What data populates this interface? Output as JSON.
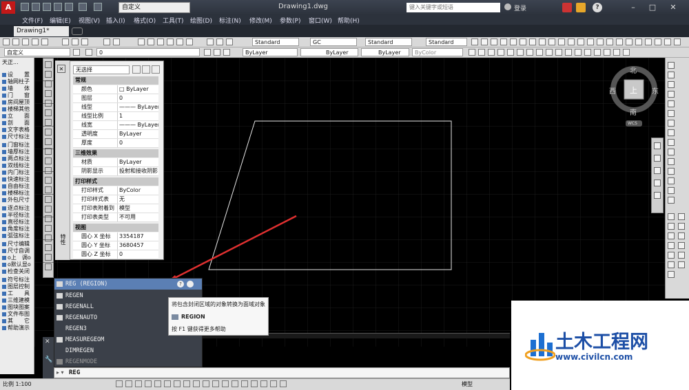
{
  "titlebar": {
    "app_logo": "A",
    "workspace": "自定义",
    "doc_title": "Drawing1.dwg",
    "search_placeholder": "键入关键字或短语",
    "login": "登录",
    "min": "–",
    "max": "□",
    "close": "✕"
  },
  "menu": [
    "文件(F)",
    "编辑(E)",
    "视图(V)",
    "插入(I)",
    "格式(O)",
    "工具(T)",
    "绘图(D)",
    "标注(N)",
    "修改(M)",
    "参数(P)",
    "窗口(W)",
    "帮助(H)"
  ],
  "tabs": {
    "active": "Drawing1*"
  },
  "toolbar2": {
    "text_style": "Standard",
    "dim_style": "GC",
    "table_style": "Standard",
    "mleader_style": "Standard"
  },
  "toolbar3": {
    "workspace": "自定义",
    "layer": "0",
    "color": "ByLayer",
    "linetype": "ByLayer",
    "lineweight": "ByLayer",
    "plotstyle": "ByColor"
  },
  "left_palette": [
    "天正...",
    "设　　置",
    "轴网柱子",
    "墙　　体",
    "门　　窗",
    "房间屋顶",
    "楼梯其他",
    "立　　面",
    "剖　　面",
    "文字表格",
    "尺寸标注",
    "门窗标注",
    "墙厚标注",
    "两点标注",
    "双线标注",
    "内门标注",
    "快速标注",
    "自由标注",
    "楼梯标注",
    "外包尺寸",
    "逐点标注",
    "半径标注",
    "直径标注",
    "角度标注",
    "弧弦标注",
    "尺寸编辑",
    "尺寸自调",
    "o上　调o",
    "o默认显o",
    "检查关闭",
    "符号标注",
    "图层控制",
    "工　　具",
    "三维建模",
    "图块图案",
    "文件布图",
    "其　　它",
    "帮助演示"
  ],
  "properties": {
    "selection": "无选择",
    "sections": [
      {
        "title": "常规",
        "rows": [
          [
            "颜色",
            "□ ByLayer"
          ],
          [
            "图层",
            "0"
          ],
          [
            "线型",
            "——— ByLayer"
          ],
          [
            "线型比例",
            "1"
          ],
          [
            "线宽",
            "——— ByLayer"
          ],
          [
            "透明度",
            "ByLayer"
          ],
          [
            "厚度",
            "0"
          ]
        ]
      },
      {
        "title": "三维效果",
        "rows": [
          [
            "材质",
            "ByLayer"
          ],
          [
            "阴影显示",
            "投射和接收阴影"
          ]
        ]
      },
      {
        "title": "打印样式",
        "rows": [
          [
            "打印样式",
            "ByColor"
          ],
          [
            "打印样式表",
            "无"
          ],
          [
            "打印表附着到",
            "模型"
          ],
          [
            "打印表类型",
            "不可用"
          ]
        ]
      },
      {
        "title": "视图",
        "rows": [
          [
            "圆心 X 坐标",
            "3354187"
          ],
          [
            "圆心 Y 坐标",
            "3680457"
          ],
          [
            "圆心 Z 坐标",
            "0"
          ]
        ]
      }
    ],
    "side_label": "特性"
  },
  "viewcube": {
    "north": "北",
    "south": "南",
    "east": "东",
    "west": "西",
    "face": "上",
    "wcs": "WCS"
  },
  "autocomplete": {
    "header": "REG (REGION)",
    "items": [
      "REGEN",
      "REGENALL",
      "REGENAUTO",
      "REGEN3",
      "MEASUREGEOM",
      "DIMREGEN",
      "REGENMODE"
    ],
    "tip_desc": "将包含封闭区域的对象转换为面域对象",
    "tip_cmd": "REGION",
    "tip_help": "按 F1 键获得更多帮助"
  },
  "command": {
    "prefix": "▸ ▾",
    "text": "REG"
  },
  "status": {
    "scale": "比例 1:100",
    "model": "模型"
  },
  "watermark": {
    "text": "土木工程网",
    "url": "www.civilcn.com"
  }
}
